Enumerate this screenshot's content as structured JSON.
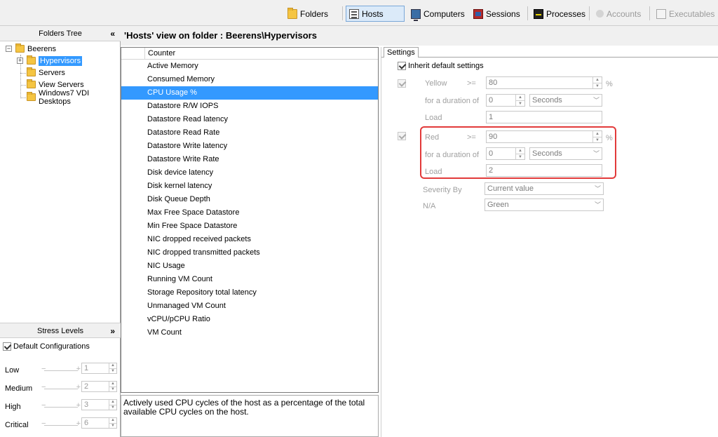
{
  "toolbar": {
    "items": [
      {
        "label": "Folders",
        "icon": "folder-icon",
        "state": "normal"
      },
      {
        "label": "Hosts",
        "icon": "hosts-icon",
        "state": "active"
      },
      {
        "label": "Computers",
        "icon": "computer-icon",
        "state": "normal"
      },
      {
        "label": "Sessions",
        "icon": "sessions-icon",
        "state": "normal"
      },
      {
        "label": "Processes",
        "icon": "processes-icon",
        "state": "normal"
      },
      {
        "label": "Accounts",
        "icon": "accounts-icon",
        "state": "disabled"
      },
      {
        "label": "Executables",
        "icon": "executables-icon",
        "state": "disabled"
      }
    ]
  },
  "folders_tree": {
    "title": "Folders Tree",
    "collapse_glyph": "«",
    "root": "Beerens",
    "children": [
      {
        "label": "Hypervisors",
        "selected": true
      },
      {
        "label": "Servers",
        "selected": false
      },
      {
        "label": "View Servers",
        "selected": false
      },
      {
        "label": "Windows7 VDI Desktops",
        "selected": false
      }
    ]
  },
  "stress_levels": {
    "title": "Stress Levels",
    "expand_glyph": "»",
    "default_config_label": "Default Configurations",
    "default_config_checked": true,
    "levels": [
      {
        "label": "Low",
        "value": "1"
      },
      {
        "label": "Medium",
        "value": "2"
      },
      {
        "label": "High",
        "value": "3"
      },
      {
        "label": "Critical",
        "value": "6"
      }
    ]
  },
  "view": {
    "title": "'Hosts' view on folder : Beerens\\Hypervisors",
    "column_header": "Counter",
    "selected_index": 2,
    "counters": [
      "Active Memory",
      "Consumed Memory",
      "CPU Usage %",
      "Datastore R/W IOPS",
      "Datastore Read latency",
      "Datastore Read Rate",
      "Datastore Write latency",
      "Datastore Write Rate",
      "Disk device latency",
      "Disk kernel latency",
      "Disk Queue Depth",
      "Max Free Space Datastore",
      "Min Free Space Datastore",
      "NIC dropped received packets",
      "NIC dropped transmitted packets",
      "NIC Usage",
      "Running VM Count",
      "Storage Repository total latency",
      "Unmanaged VM Count",
      "vCPU/pCPU Ratio",
      "VM Count"
    ],
    "description": "Actively used CPU cycles of the host as a percentage of the total available CPU cycles on the host."
  },
  "settings": {
    "tab_label": "Settings",
    "inherit_label": "Inherit default settings",
    "inherit_checked": true,
    "yellow": {
      "enabled_checked": true,
      "label": "Yellow",
      "operator": ">=",
      "threshold": "80",
      "unit": "%",
      "duration_label": "for a duration of",
      "duration": "0",
      "duration_unit": "Seconds",
      "load_label": "Load",
      "load": "1"
    },
    "red": {
      "enabled_checked": true,
      "label": "Red",
      "operator": ">=",
      "threshold": "90",
      "unit": "%",
      "duration_label": "for a duration of",
      "duration": "0",
      "duration_unit": "Seconds",
      "load_label": "Load",
      "load": "2"
    },
    "severity_label": "Severity By",
    "severity_value": "Current value",
    "na_label": "N/A",
    "na_value": "Green"
  },
  "colors": {
    "selection": "#3399ff",
    "highlight_border": "#e23a3a",
    "toolbar_bg": "#f0f0f0"
  }
}
